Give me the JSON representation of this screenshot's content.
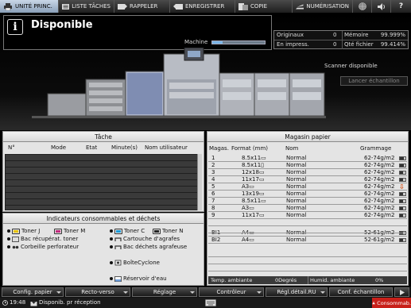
{
  "tabs": [
    {
      "label": "UNITÉ PRINC.",
      "icon": "printer-icon"
    },
    {
      "label": "LISTE TÂCHES",
      "icon": "list-icon"
    },
    {
      "label": "RAPPELER",
      "icon": "recall-icon"
    },
    {
      "label": "ENREGISTRER",
      "icon": "save-icon"
    },
    {
      "label": "COPIE",
      "icon": "copy-icon"
    },
    {
      "label": "NUMÉRISATION",
      "icon": "scan-icon"
    }
  ],
  "status": {
    "title": "Disponible",
    "machine_label": "Machine",
    "machine_progress": 0.2,
    "scanner_text": "Scanner disponible",
    "sample_button": "Lancer échantillon"
  },
  "counters": {
    "originals_label": "Originaux",
    "originals_value": "0",
    "memory_label": "Mémoire",
    "memory_value": "99.999%",
    "printing_label": "En impress.",
    "printing_value": "0",
    "file_label": "Qté fichier",
    "file_value": "99.414%"
  },
  "task": {
    "title": "Tâche",
    "columns": [
      "N°",
      "Mode",
      "Etat",
      "Minute(s)",
      "Nom utilisateur"
    ]
  },
  "consumables": {
    "title": "Indicateurs consommables et déchets",
    "items": [
      "Toner J",
      "Toner M",
      "Toner C",
      "Toner N",
      "Bac récupérat. toner",
      "Cartouche d'agrafes",
      "Corbeille perforateur",
      "Bac déchets agrafeuse",
      "BoîteCyclone",
      "Réservoir d'eau"
    ]
  },
  "paper": {
    "title": "Magasin papier",
    "columns": [
      "Magas.",
      "Format (mm)",
      "Nom",
      "Grammage"
    ],
    "rows": [
      {
        "tray": "1",
        "size": "8.5x11▭",
        "name": "Normal",
        "weight": "62-74g/m2",
        "level": 0.7
      },
      {
        "tray": "2",
        "size": "8.5x11▯",
        "name": "Normal",
        "weight": "62-74g/m2",
        "level": 0.7
      },
      {
        "tray": "3",
        "size": "12x18▭",
        "name": "Normal",
        "weight": "62-74g/m2",
        "level": 0.5
      },
      {
        "tray": "4",
        "size": "11x17▭",
        "name": "Normal",
        "weight": "62-74g/m2",
        "level": 0.5
      },
      {
        "tray": "5",
        "size": "A3▭",
        "name": "Normal",
        "weight": "62-74g/m2",
        "level": 0.0,
        "warning": "⇩"
      },
      {
        "tray": "6",
        "size": "13x19▭",
        "name": "Normal",
        "weight": "62-74g/m2",
        "level": 0.5
      },
      {
        "tray": "7",
        "size": "8.5x11▭",
        "name": "Normal",
        "weight": "62-74g/m2",
        "level": 0.5
      },
      {
        "tray": "8",
        "size": "A3▭",
        "name": "Normal",
        "weight": "62-74g/m2",
        "level": 0.5
      },
      {
        "tray": "9",
        "size": "11x17▭",
        "name": "Normal",
        "weight": "62-74g/m2",
        "level": 0.5
      },
      {
        "tray": "BI1",
        "size": "A4▭",
        "name": "Normal",
        "weight": "52-61g/m2",
        "level": 0.5
      },
      {
        "tray": "BI2",
        "size": "A4▭",
        "name": "Normal",
        "weight": "52-61g/m2",
        "level": 0.5
      }
    ],
    "temp_label": "Temp. ambiante",
    "temp_value": "0Degrés",
    "hum_label": "Humid. ambiante",
    "hum_value": "0%"
  },
  "bottom_buttons": [
    {
      "label": "Config. papier"
    },
    {
      "label": "Recto-verso"
    },
    {
      "label": "Réglage"
    },
    {
      "label": "Contrôleur"
    },
    {
      "label": "Régl.détail.RU"
    },
    {
      "label": "Conf. échantillon"
    }
  ],
  "statusline": {
    "time": "19:48",
    "message": "Disponib. pr réception",
    "alert": "Consommab."
  }
}
